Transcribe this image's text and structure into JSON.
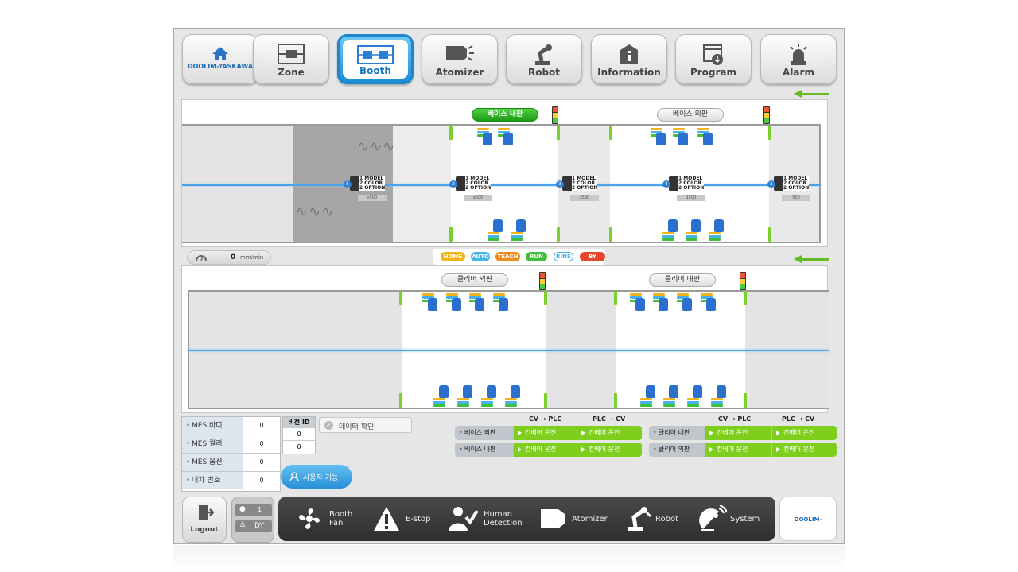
{
  "nav": {
    "home_label": "DOOLIM-YASKAWA",
    "items": [
      {
        "label": "Zone",
        "icon": "zone-icon"
      },
      {
        "label": "Booth",
        "icon": "booth-icon",
        "active": true
      },
      {
        "label": "Atomizer",
        "icon": "atomizer-icon"
      },
      {
        "label": "Robot",
        "icon": "robot-icon"
      },
      {
        "label": "Information",
        "icon": "information-icon"
      },
      {
        "label": "Program",
        "icon": "program-icon"
      },
      {
        "label": "Alarm",
        "icon": "alarm-icon"
      }
    ]
  },
  "booth_upper": {
    "zone1": "베이스 내판",
    "zone2": "베이스 외판",
    "carrier_lines": [
      "1  MODEL",
      "2  COLOR",
      "2  OPTION"
    ],
    "carriers": [
      {
        "num": "5",
        "count": "x500"
      },
      {
        "num": "2",
        "count": "x500"
      },
      {
        "num": "3",
        "count": "2500"
      },
      {
        "num": "4",
        "count": "1500"
      },
      {
        "num": "5",
        "count": "500"
      }
    ]
  },
  "booth_lower": {
    "zone1": "클리어 외판",
    "zone2": "클리어 내판"
  },
  "speed": {
    "value": "0",
    "unit": "mm/min"
  },
  "legend": [
    {
      "label": "HOME",
      "color": "#f2b21a"
    },
    {
      "label": "AUTO",
      "color": "#45b3e8"
    },
    {
      "label": "TEACH",
      "color": "#f08a1c"
    },
    {
      "label": "RUN",
      "color": "#3fbf3a"
    },
    {
      "label": "RINS",
      "color": "#ffffff"
    },
    {
      "label": "BY PASS",
      "color": "#e4452c"
    }
  ],
  "mes": [
    {
      "label": "MES 바디",
      "value": "0"
    },
    {
      "label": "MES 컬러",
      "value": "0"
    },
    {
      "label": "MES 옵션",
      "value": "0"
    },
    {
      "label": "대차 번호",
      "value": "0"
    }
  ],
  "version": {
    "header": "비전 ID",
    "values": [
      "0",
      "0"
    ]
  },
  "data_check": "데이터 확인",
  "user_function": "사용자 기능",
  "conveyor": {
    "headers": [
      "CV → PLC",
      "PLC → CV"
    ],
    "left": [
      {
        "name": "베이스 외판",
        "a": "컨베어 운전",
        "b": "컨베어 운전"
      },
      {
        "name": "베이스 내판",
        "a": "컨베어 운전",
        "b": "컨베어 운전"
      }
    ],
    "right": [
      {
        "name": "클리어 내판",
        "a": "컨베어 운전",
        "b": "컨베어 운전"
      },
      {
        "name": "클리어 외판",
        "a": "컨베어 운전",
        "b": "컨베어 운전"
      }
    ]
  },
  "footer": {
    "logout": "Logout",
    "user_level": "1",
    "user_name": "DY",
    "dock": [
      {
        "label1": "Booth",
        "label2": "Fan",
        "icon": "fan-icon"
      },
      {
        "label1": "E-stop",
        "label2": "",
        "icon": "warning-icon"
      },
      {
        "label1": "Human",
        "label2": "Detection",
        "icon": "human-detection-icon"
      },
      {
        "label1": "Atomizer",
        "label2": "",
        "icon": "atomizer-icon"
      },
      {
        "label1": "Robot",
        "label2": "",
        "icon": "robot-icon"
      },
      {
        "label1": "System",
        "label2": "",
        "icon": "system-icon"
      }
    ],
    "brand": "DOOLIM-YASKAWA"
  }
}
